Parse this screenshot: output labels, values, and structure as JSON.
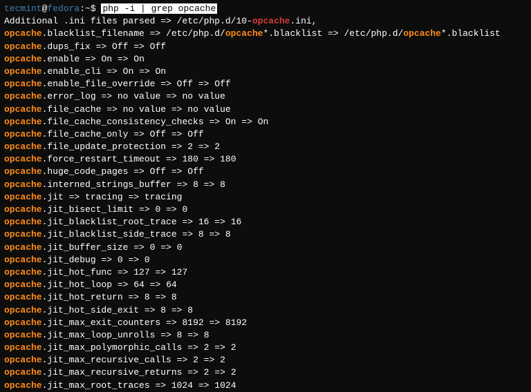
{
  "prompt": {
    "user": "tecmint",
    "at": "@",
    "host": "fedora",
    "path": ":~",
    "dollar": "$ ",
    "command": "php -i | grep opcache"
  },
  "additional_line_parts": {
    "pre": "Additional .ini files parsed => /etc/php.d/10-",
    "hl1": "opcache",
    "post": ".ini,"
  },
  "blacklist_line": {
    "hl1": "opcache",
    "t1": ".blacklist_filename => /etc/php.d/",
    "hl2": "opcache",
    "t2": "*.blacklist => /etc/php.d/",
    "hl3": "opcache",
    "t3": "*.blacklist"
  },
  "settings": [
    {
      "key": "opcache",
      "name": ".dups_fix",
      "v1": "Off",
      "v2": "Off"
    },
    {
      "key": "opcache",
      "name": ".enable",
      "v1": "On",
      "v2": "On"
    },
    {
      "key": "opcache",
      "name": ".enable_cli",
      "v1": "On",
      "v2": "On"
    },
    {
      "key": "opcache",
      "name": ".enable_file_override",
      "v1": "Off",
      "v2": "Off"
    },
    {
      "key": "opcache",
      "name": ".error_log",
      "v1": "no value",
      "v2": "no value"
    },
    {
      "key": "opcache",
      "name": ".file_cache",
      "v1": "no value",
      "v2": "no value"
    },
    {
      "key": "opcache",
      "name": ".file_cache_consistency_checks",
      "v1": "On",
      "v2": "On"
    },
    {
      "key": "opcache",
      "name": ".file_cache_only",
      "v1": "Off",
      "v2": "Off"
    },
    {
      "key": "opcache",
      "name": ".file_update_protection",
      "v1": "2",
      "v2": "2"
    },
    {
      "key": "opcache",
      "name": ".force_restart_timeout",
      "v1": "180",
      "v2": "180"
    },
    {
      "key": "opcache",
      "name": ".huge_code_pages",
      "v1": "Off",
      "v2": "Off"
    },
    {
      "key": "opcache",
      "name": ".interned_strings_buffer",
      "v1": "8",
      "v2": "8"
    },
    {
      "key": "opcache",
      "name": ".jit",
      "v1": "tracing",
      "v2": "tracing"
    },
    {
      "key": "opcache",
      "name": ".jit_bisect_limit",
      "v1": "0",
      "v2": "0"
    },
    {
      "key": "opcache",
      "name": ".jit_blacklist_root_trace",
      "v1": "16",
      "v2": "16"
    },
    {
      "key": "opcache",
      "name": ".jit_blacklist_side_trace",
      "v1": "8",
      "v2": "8"
    },
    {
      "key": "opcache",
      "name": ".jit_buffer_size",
      "v1": "0",
      "v2": "0"
    },
    {
      "key": "opcache",
      "name": ".jit_debug",
      "v1": "0",
      "v2": "0"
    },
    {
      "key": "opcache",
      "name": ".jit_hot_func",
      "v1": "127",
      "v2": "127"
    },
    {
      "key": "opcache",
      "name": ".jit_hot_loop",
      "v1": "64",
      "v2": "64"
    },
    {
      "key": "opcache",
      "name": ".jit_hot_return",
      "v1": "8",
      "v2": "8"
    },
    {
      "key": "opcache",
      "name": ".jit_hot_side_exit",
      "v1": "8",
      "v2": "8"
    },
    {
      "key": "opcache",
      "name": ".jit_max_exit_counters",
      "v1": "8192",
      "v2": "8192"
    },
    {
      "key": "opcache",
      "name": ".jit_max_loop_unrolls",
      "v1": "8",
      "v2": "8"
    },
    {
      "key": "opcache",
      "name": ".jit_max_polymorphic_calls",
      "v1": "2",
      "v2": "2"
    },
    {
      "key": "opcache",
      "name": ".jit_max_recursive_calls",
      "v1": "2",
      "v2": "2"
    },
    {
      "key": "opcache",
      "name": ".jit_max_recursive_returns",
      "v1": "2",
      "v2": "2"
    },
    {
      "key": "opcache",
      "name": ".jit_max_root_traces",
      "v1": "1024",
      "v2": "1024"
    }
  ],
  "arrow": " => "
}
